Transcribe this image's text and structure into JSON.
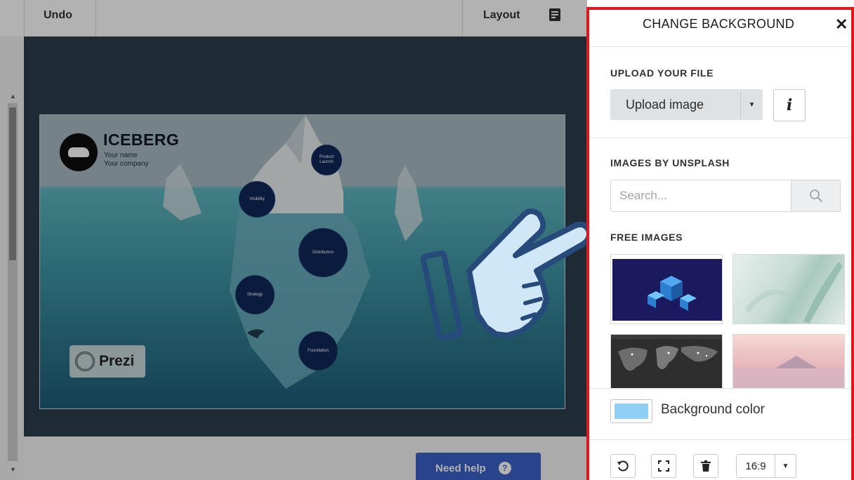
{
  "toolbar": {
    "undo_label": "Undo",
    "layout_label": "Layout",
    "layout_icon": "layout-icon"
  },
  "slide": {
    "title": "ICEBERG",
    "subtitle_1": "Your name",
    "subtitle_2": "Your company",
    "topics": [
      "Product Launch",
      "Visibility",
      "Distribution",
      "Strategy",
      "Foundation"
    ],
    "brand": "Prezi"
  },
  "help": {
    "label": "Need help",
    "icon": "?"
  },
  "panel": {
    "title": "CHANGE BACKGROUND",
    "close_icon": "✕",
    "upload_section": "UPLOAD YOUR FILE",
    "upload_button": "Upload image",
    "info_button": "i",
    "unsplash_section": "IMAGES BY UNSPLASH",
    "search_placeholder": "Search...",
    "free_images_section": "FREE IMAGES",
    "thumbnails": [
      "isometric-servers-image",
      "frosted-leaf-image",
      "world-map-lights-image",
      "pink-sunset-mountain-image"
    ],
    "bg_color_label": "Background color",
    "bg_color": "#8fcff6",
    "ratio_label": "16:9"
  },
  "colors": {
    "panel_border": "#e5161b",
    "help_button": "#3b62c6",
    "topic_circle": "#0f2758"
  }
}
